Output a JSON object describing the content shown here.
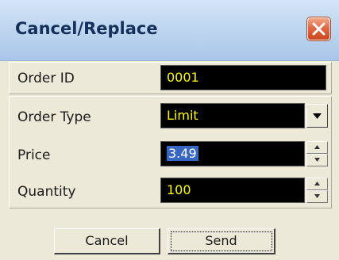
{
  "window": {
    "title": "Cancel/Replace"
  },
  "order_id": {
    "label": "Order ID",
    "value": "0001"
  },
  "order_type": {
    "label": "Order Type",
    "value": "Limit"
  },
  "price": {
    "label": "Price",
    "value": "3.49"
  },
  "quantity": {
    "label": "Quantity",
    "value": "100"
  },
  "buttons": {
    "cancel": "Cancel",
    "send": "Send"
  },
  "colors": {
    "field_background": "#000000",
    "field_text": "#ffff00",
    "selection": "#3767c1",
    "dialog_background": "#ece9d8"
  },
  "icons": {
    "close": "close-icon",
    "dropdown": "chevron-down-icon",
    "spin_up": "spin-up-icon",
    "spin_down": "spin-down-icon"
  }
}
